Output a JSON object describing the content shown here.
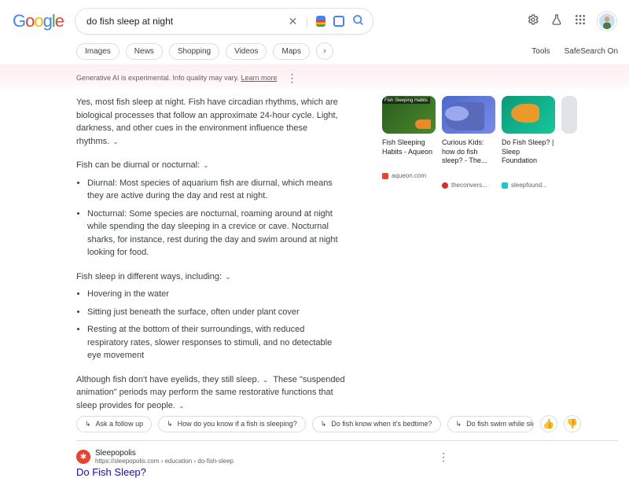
{
  "search": {
    "query": "do fish sleep at night"
  },
  "tabs": [
    "Images",
    "News",
    "Shopping",
    "Videos",
    "Maps"
  ],
  "toolbar": {
    "tools": "Tools",
    "safesearch": "SafeSearch On"
  },
  "disclaimer": {
    "text": "Generative AI is experimental. Info quality may vary. ",
    "link": "Learn more"
  },
  "answer": {
    "intro": "Yes, most fish sleep at night. Fish have circadian rhythms, which are biological processes that follow an approximate 24-hour cycle. Light, darkness, and other cues in the environment influence these rhythms.",
    "sec1_head": "Fish can be diurnal or nocturnal:",
    "bul1a": "Diurnal: Most species of aquarium fish are diurnal, which means they are active during the day and rest at night.",
    "bul1b": "Nocturnal: Some species are nocturnal, roaming around at night while spending the day sleeping in a crevice or cave. Nocturnal sharks, for instance, rest during the day and swim around at night looking for food.",
    "sec2_head": "Fish sleep in different ways, including:",
    "bul2a": "Hovering in the water",
    "bul2b": "Sitting just beneath the surface, often under plant cover",
    "bul2c": "Resting at the bottom of their surroundings, with reduced respiratory rates, slower responses to stimuli, and no detectable eye movement",
    "closing_a": "Although fish don't have eyelids, they still sleep.",
    "closing_b": "These \"suspended animation\" periods may perform the same restorative functions that sleep provides for people."
  },
  "cards": [
    {
      "title": "Fish Sleeping Habits - Aqueon",
      "src": "aqueon.com",
      "badge": "Fish Sleeping Habits",
      "bg": "#2a5a1e",
      "dot": "#e8432e"
    },
    {
      "title": "Curious Kids: how do fish sleep? - The...",
      "src": "theconvers...",
      "bg": "#3a5aab",
      "dot": "#d93025"
    },
    {
      "title": "Do Fish Sleep? | Sleep Foundation",
      "src": "sleepfound...",
      "bg": "#0a7a5a",
      "dot": "#1ec6c6"
    }
  ],
  "chips": {
    "followup": "Ask a follow up",
    "c1": "How do you know if a fish is sleeping?",
    "c2": "Do fish know when it's bedtime?",
    "c3": "Do fish swim while sleeping?"
  },
  "result": {
    "site": "Sleepopolis",
    "url": "https://sleepopolis.com › education › do-fish-sleep",
    "title": "Do Fish Sleep?"
  }
}
